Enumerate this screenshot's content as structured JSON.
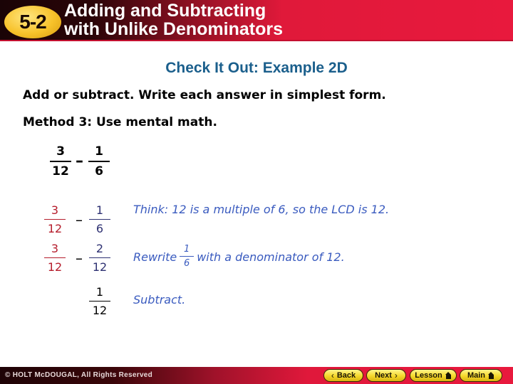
{
  "header": {
    "lesson_number": "5-2",
    "title_line1": "Adding and Subtracting",
    "title_line2": "with Unlike Denominators",
    "colors": {
      "badge": "#f7c22a",
      "header_red": "#e8193d",
      "header_dark": "#1a0406"
    }
  },
  "subtitle": "Check It Out: Example 2D",
  "instruction": "Add or subtract. Write each answer in simplest form.",
  "method": "Method 3: Use mental math.",
  "expression": {
    "left": {
      "num": "3",
      "den": "12"
    },
    "operator": "–",
    "right": {
      "num": "1",
      "den": "6"
    }
  },
  "steps": [
    {
      "left": {
        "num": "3",
        "den": "12"
      },
      "operator": "–",
      "right": {
        "num": "1",
        "den": "6"
      },
      "note": "Think: 12 is a multiple of 6, so the LCD is 12."
    },
    {
      "left": {
        "num": "3",
        "den": "12"
      },
      "operator": "–",
      "right": {
        "num": "2",
        "den": "12"
      },
      "note_before": "Rewrite",
      "note_frac": {
        "num": "1",
        "den": "6"
      },
      "note_after": "with a denominator of 12."
    },
    {
      "result": {
        "num": "1",
        "den": "12"
      },
      "note": "Subtract."
    }
  ],
  "colors": {
    "subtitle": "#1b5f8c",
    "note_text": "#3a5bbf",
    "left_fraction": "#b51d2c",
    "right_fraction": "#2e3172"
  },
  "footer": {
    "copyright": "© HOLT McDOUGAL, All Rights Reserved",
    "buttons": {
      "back": "Back",
      "next": "Next",
      "lesson": "Lesson",
      "main": "Main"
    },
    "icons": {
      "back": "chevron-left-icon",
      "next": "chevron-right-icon",
      "lesson": "home-icon",
      "main": "home-icon"
    }
  }
}
